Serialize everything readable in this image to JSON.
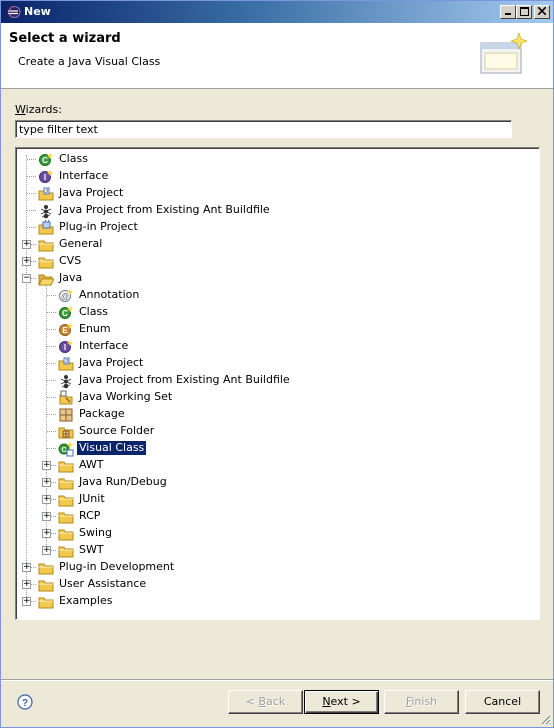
{
  "window": {
    "title": "New"
  },
  "banner": {
    "heading": "Select a wizard",
    "description": "Create a Java Visual Class"
  },
  "wizards_label": {
    "first": "W",
    "rest": "izards:"
  },
  "filter": {
    "value": "type filter text"
  },
  "tree": {
    "items": [
      {
        "label": "Class",
        "icon": "class-icon",
        "depth": 0,
        "expander": "none"
      },
      {
        "label": "Interface",
        "icon": "interface-icon",
        "depth": 0,
        "expander": "none"
      },
      {
        "label": "Java Project",
        "icon": "java-project-icon",
        "depth": 0,
        "expander": "none"
      },
      {
        "label": "Java Project from Existing Ant Buildfile",
        "icon": "ant-icon",
        "depth": 0,
        "expander": "none"
      },
      {
        "label": "Plug-in Project",
        "icon": "plugin-project-icon",
        "depth": 0,
        "expander": "none"
      },
      {
        "label": "General",
        "icon": "folder-icon",
        "depth": 0,
        "expander": "collapsed"
      },
      {
        "label": "CVS",
        "icon": "folder-icon",
        "depth": 0,
        "expander": "collapsed"
      },
      {
        "label": "Java",
        "icon": "folder-open-icon",
        "depth": 0,
        "expander": "expanded"
      },
      {
        "label": "Annotation",
        "icon": "annotation-icon",
        "depth": 1,
        "expander": "none"
      },
      {
        "label": "Class",
        "icon": "class-icon",
        "depth": 1,
        "expander": "none"
      },
      {
        "label": "Enum",
        "icon": "enum-icon",
        "depth": 1,
        "expander": "none"
      },
      {
        "label": "Interface",
        "icon": "interface-icon",
        "depth": 1,
        "expander": "none"
      },
      {
        "label": "Java Project",
        "icon": "java-project-icon",
        "depth": 1,
        "expander": "none"
      },
      {
        "label": "Java Project from Existing Ant Buildfile",
        "icon": "ant-icon",
        "depth": 1,
        "expander": "none"
      },
      {
        "label": "Java Working Set",
        "icon": "working-set-icon",
        "depth": 1,
        "expander": "none"
      },
      {
        "label": "Package",
        "icon": "package-icon",
        "depth": 1,
        "expander": "none"
      },
      {
        "label": "Source Folder",
        "icon": "source-folder-icon",
        "depth": 1,
        "expander": "none"
      },
      {
        "label": "Visual Class",
        "icon": "visual-class-icon",
        "depth": 1,
        "expander": "none",
        "selected": true
      },
      {
        "label": "AWT",
        "icon": "folder-icon",
        "depth": 1,
        "expander": "collapsed"
      },
      {
        "label": "Java Run/Debug",
        "icon": "folder-icon",
        "depth": 1,
        "expander": "collapsed"
      },
      {
        "label": "JUnit",
        "icon": "folder-icon",
        "depth": 1,
        "expander": "collapsed"
      },
      {
        "label": "RCP",
        "icon": "folder-icon",
        "depth": 1,
        "expander": "collapsed"
      },
      {
        "label": "Swing",
        "icon": "folder-icon",
        "depth": 1,
        "expander": "collapsed"
      },
      {
        "label": "SWT",
        "icon": "folder-icon",
        "depth": 1,
        "expander": "collapsed"
      },
      {
        "label": "Plug-in Development",
        "icon": "folder-icon",
        "depth": 0,
        "expander": "collapsed"
      },
      {
        "label": "User Assistance",
        "icon": "folder-icon",
        "depth": 0,
        "expander": "collapsed"
      },
      {
        "label": "Examples",
        "icon": "folder-icon",
        "depth": 0,
        "expander": "collapsed"
      }
    ]
  },
  "buttons": {
    "back": {
      "prefix": "< ",
      "mnemonic": "B",
      "rest": "ack",
      "enabled": false
    },
    "next": {
      "mnemonic": "N",
      "rest": "ext >",
      "enabled": true
    },
    "finish": {
      "mnemonic": "F",
      "rest": "inish",
      "enabled": false
    },
    "cancel": {
      "label": "Cancel",
      "enabled": true
    }
  },
  "colors": {
    "selection": "#0a246a",
    "titlebar": "#0a246a",
    "java_class_green": "#3c9b3c",
    "interface_purple": "#6a4ca3",
    "folder_yellow": "#f2c94c"
  }
}
